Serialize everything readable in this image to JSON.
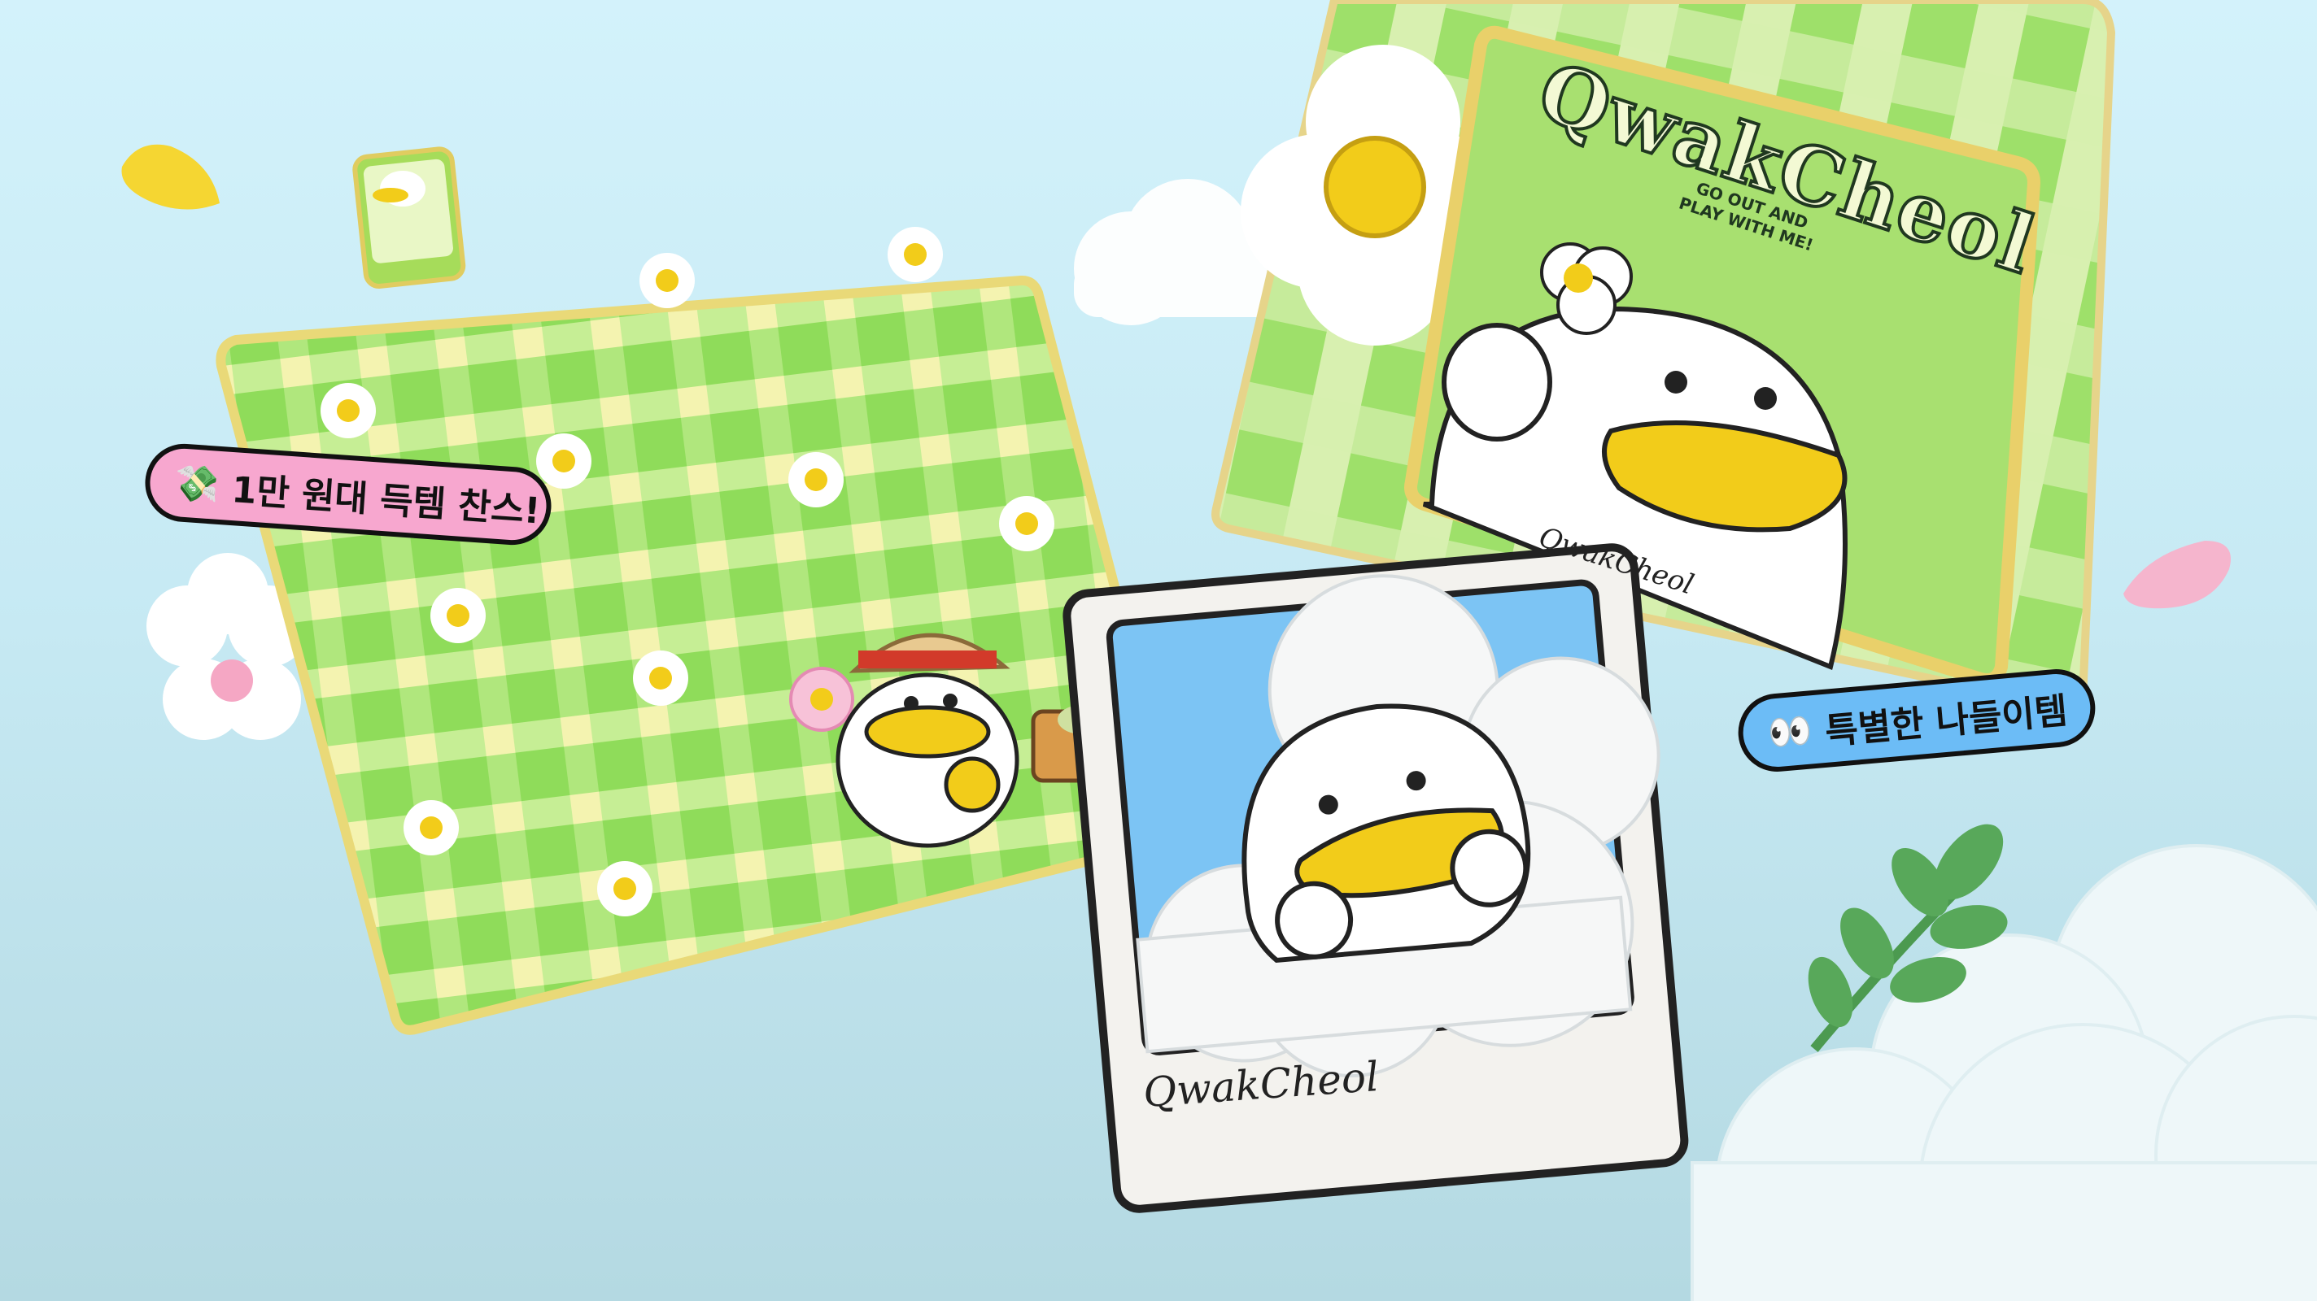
{
  "badges": {
    "deal": {
      "emoji": "💸",
      "text": "1만 원대 득템 찬스!"
    },
    "special": {
      "emoji": "👀",
      "text": "특별한 나들이템"
    }
  },
  "polaroid": {
    "caption": "QwakCheol"
  },
  "bag": {
    "title": "QwakCheol",
    "slogan": "GO OUT AND PLAY WITH ME!",
    "brand": "QwakCheol"
  },
  "colors": {
    "sky": "#d3f2fb",
    "mat_green": "#8fdc5a",
    "mat_yellow": "#f4f3b0",
    "duck_bill": "#f2cc1a",
    "pill_pink": "#f7a7cf",
    "pill_blue": "#6cbcf6"
  }
}
